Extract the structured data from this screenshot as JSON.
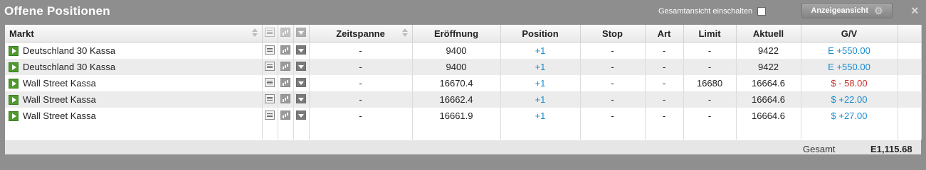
{
  "panel": {
    "title": "Offene Positionen",
    "gesamt_toggle_label": "Gesamtansicht einschalten",
    "anzeige_button_label": "Anzeigeansicht",
    "close_icon": "×"
  },
  "columns": {
    "markt": "Markt",
    "zeitspanne": "Zeitspanne",
    "eroeffnung": "Eröffnung",
    "position": "Position",
    "stop": "Stop",
    "art": "Art",
    "limit": "Limit",
    "aktuell": "Aktuell",
    "gv": "G/V"
  },
  "rows": [
    {
      "markt": "Deutschland 30 Kassa",
      "zeitspanne": "-",
      "eroeffnung": "9400",
      "position": "+1",
      "stop": "-",
      "art": "-",
      "limit": "-",
      "aktuell": "9422",
      "gv": "E +550.00",
      "gv_status": "positive"
    },
    {
      "markt": "Deutschland 30 Kassa",
      "zeitspanne": "-",
      "eroeffnung": "9400",
      "position": "+1",
      "stop": "-",
      "art": "-",
      "limit": "-",
      "aktuell": "9422",
      "gv": "E +550.00",
      "gv_status": "positive"
    },
    {
      "markt": "Wall Street Kassa",
      "zeitspanne": "-",
      "eroeffnung": "16670.4",
      "position": "+1",
      "stop": "-",
      "art": "-",
      "limit": "16680",
      "aktuell": "16664.6",
      "gv": "$ - 58.00",
      "gv_status": "negative"
    },
    {
      "markt": "Wall Street Kassa",
      "zeitspanne": "-",
      "eroeffnung": "16662.4",
      "position": "+1",
      "stop": "-",
      "art": "-",
      "limit": "-",
      "aktuell": "16664.6",
      "gv": "$ +22.00",
      "gv_status": "positive"
    },
    {
      "markt": "Wall Street Kassa",
      "zeitspanne": "-",
      "eroeffnung": "16661.9",
      "position": "+1",
      "stop": "-",
      "art": "-",
      "limit": "-",
      "aktuell": "16664.6",
      "gv": "$ +27.00",
      "gv_status": "positive"
    }
  ],
  "footer": {
    "label": "Gesamt",
    "value": "E1,115.68"
  },
  "colors": {
    "positive": "#1a8ccf",
    "negative": "#c8312b",
    "play_button": "#4e9a2d"
  },
  "icons": {
    "row_actions": [
      "play-icon",
      "news-icon",
      "chart-icon",
      "dropdown-icon"
    ],
    "header_sort": "sort-icon",
    "settings": "gear-icon"
  }
}
